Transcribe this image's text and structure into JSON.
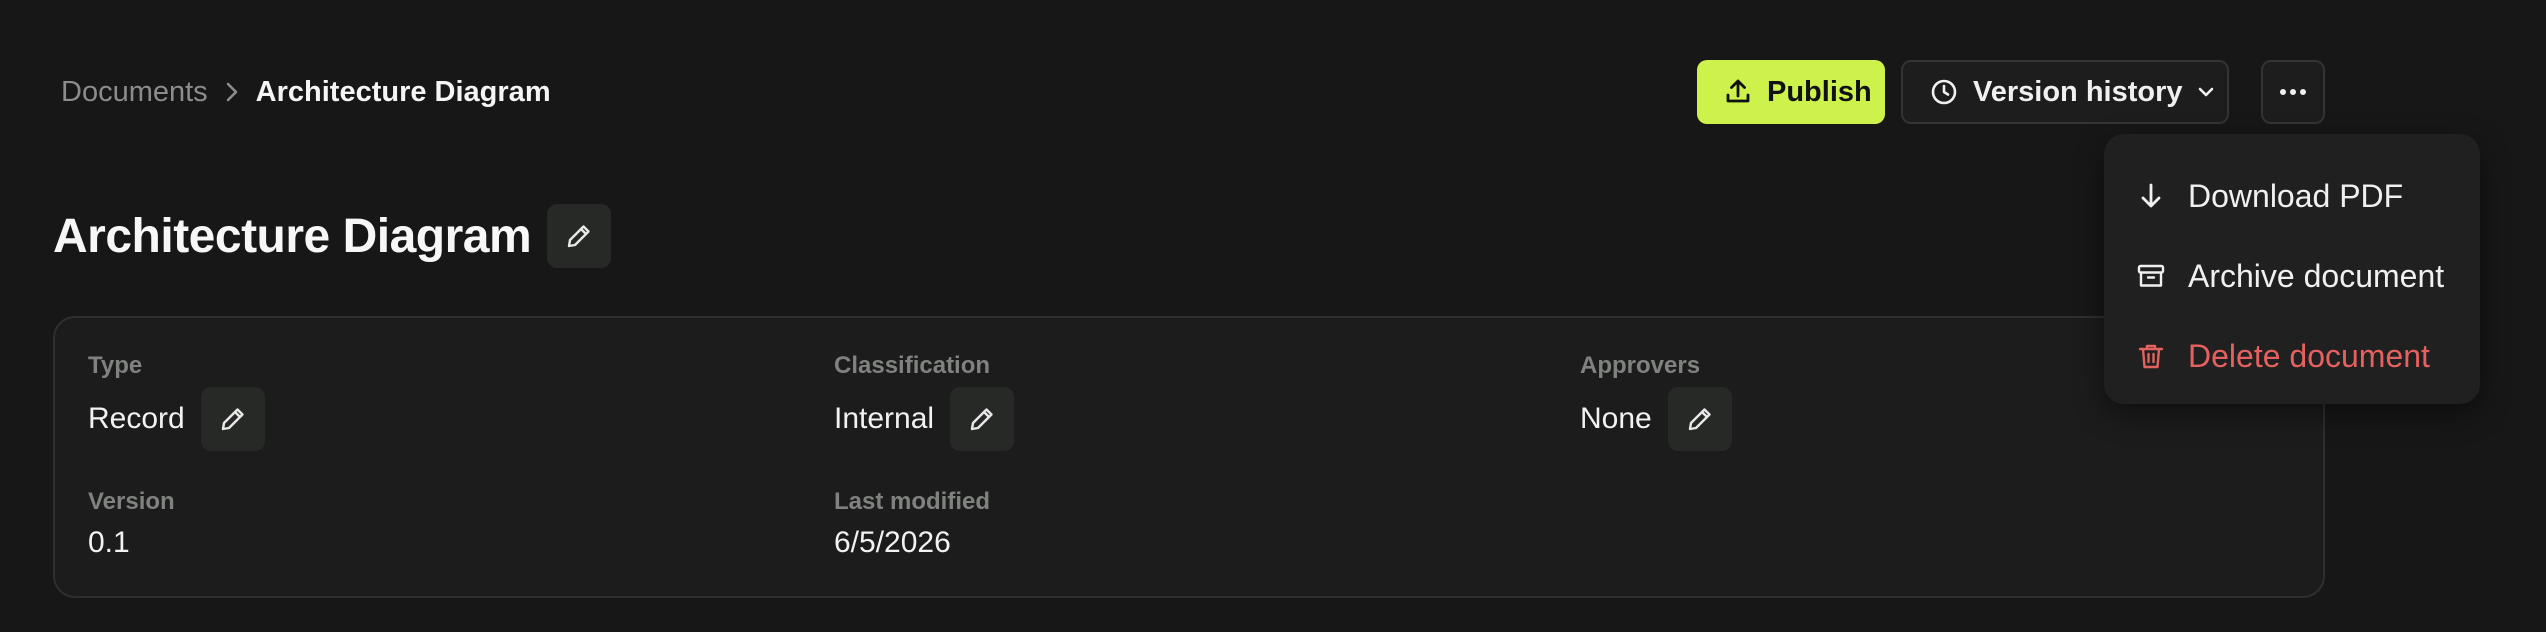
{
  "breadcrumb": {
    "root": "Documents",
    "current": "Architecture Diagram"
  },
  "toolbar": {
    "publish_label": "Publish",
    "version_history_label": "Version history"
  },
  "page": {
    "title": "Architecture Diagram"
  },
  "details": {
    "type": {
      "label": "Type",
      "value": "Record"
    },
    "classification": {
      "label": "Classification",
      "value": "Internal"
    },
    "approvers": {
      "label": "Approvers",
      "value": "None"
    },
    "version": {
      "label": "Version",
      "value": "0.1"
    },
    "last_modified": {
      "label": "Last modified",
      "value": "6/5/2026"
    }
  },
  "menu": {
    "items": [
      {
        "label": "Download PDF",
        "icon": "arrow-down-icon"
      },
      {
        "label": "Archive document",
        "icon": "archive-icon"
      },
      {
        "label": "Delete document",
        "icon": "trash-icon"
      }
    ]
  },
  "colors": {
    "background": "#161716",
    "accent": "#cdf24b",
    "danger": "#e5615f",
    "card": "#1b1c1b"
  }
}
